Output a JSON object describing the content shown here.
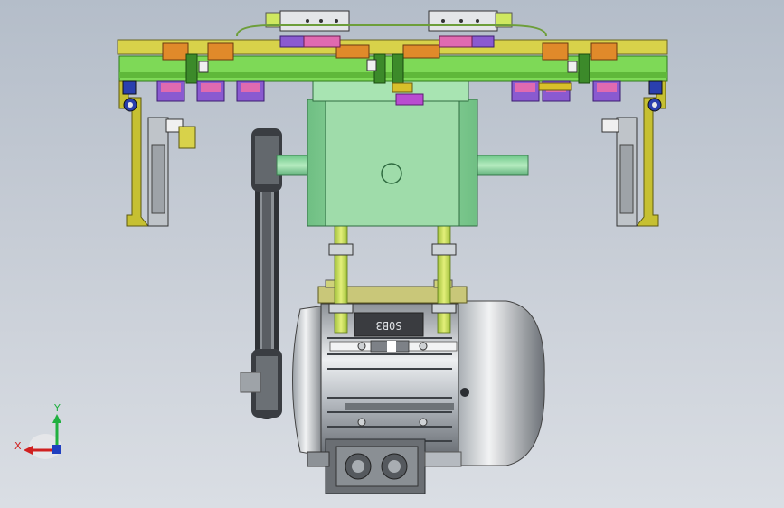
{
  "viewport": {
    "background_top": "#b4bdc9",
    "background_bottom": "#dadee4"
  },
  "model": {
    "motor_plate_text": "S0B3",
    "colors": {
      "frame_green": "#7ed957",
      "frame_yellow": "#d8d24a",
      "gearbox_green": "#8fd49b",
      "motor_silver": "#c9cdd2",
      "bracket_olive": "#c6c032",
      "clamp_purple": "#8a5ad0",
      "clamp_pink": "#e06ab0",
      "block_orange": "#e08a2a",
      "bracket_blue": "#2a3fae",
      "belt_dark": "#3a3d42"
    }
  },
  "triad": {
    "y_label": "Y",
    "x_label": "X",
    "y_color": "#20b040",
    "x_color": "#d02020"
  }
}
